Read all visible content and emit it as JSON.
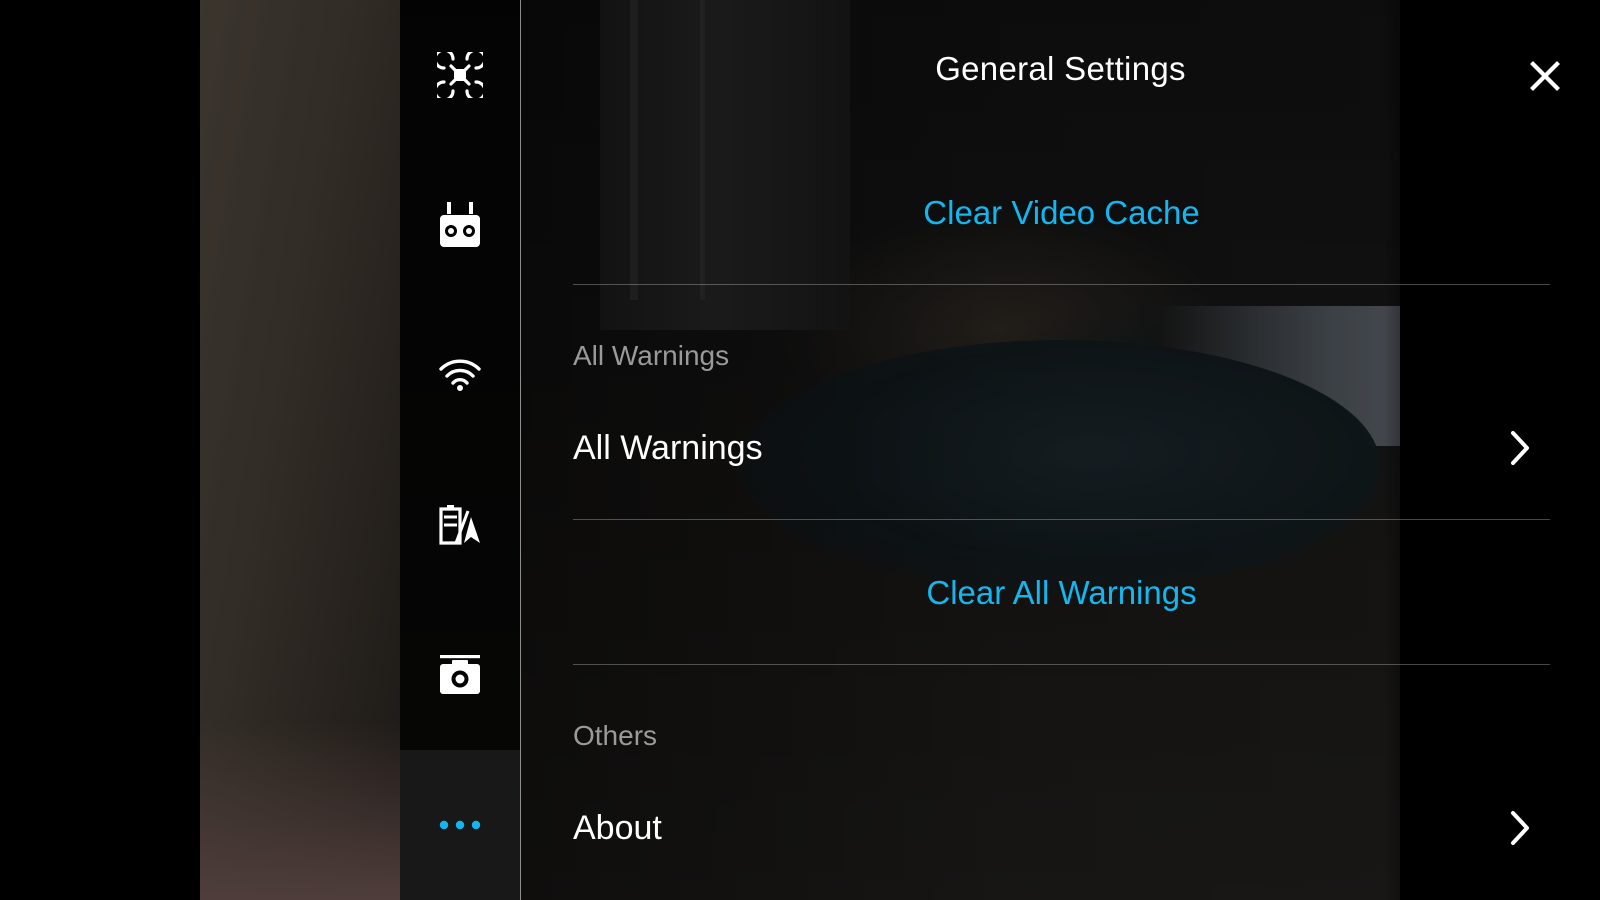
{
  "panel": {
    "title": "General Settings",
    "close_icon": "close-icon"
  },
  "nav_rail": {
    "items": [
      {
        "icon": "aircraft-icon",
        "active": false
      },
      {
        "icon": "remote-controller-icon",
        "active": false
      },
      {
        "icon": "wifi-icon",
        "active": false
      },
      {
        "icon": "battery-icon",
        "active": false
      },
      {
        "icon": "camera-icon",
        "active": false
      },
      {
        "icon": "more-icon",
        "active": true
      }
    ]
  },
  "cache": {
    "clear_video_cache_label": "Clear Video Cache"
  },
  "warnings": {
    "section_header": "All Warnings",
    "all_warnings_label": "All Warnings",
    "clear_all_warnings_label": "Clear All Warnings"
  },
  "others": {
    "section_header": "Others",
    "about_label": "About"
  },
  "colors": {
    "accent": "#12b7ef",
    "text_primary": "#ffffff",
    "text_secondary": "#9a9a9a"
  }
}
